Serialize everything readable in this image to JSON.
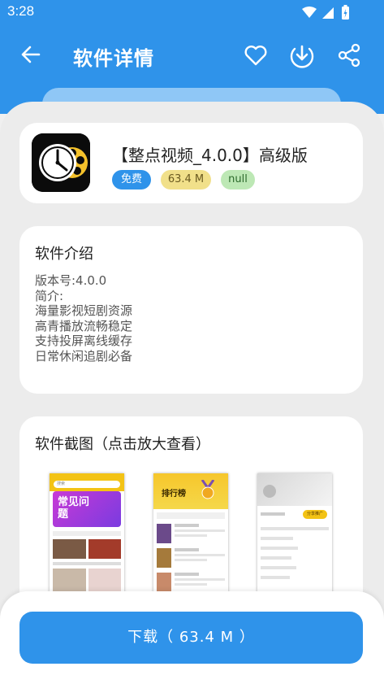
{
  "status_bar": {
    "time": "3:28"
  },
  "header": {
    "title": "软件详情"
  },
  "app": {
    "name": "【整点视频_4.0.0】高级版",
    "tags": {
      "price": "免费",
      "size": "63.4 M",
      "extra": "null"
    }
  },
  "intro": {
    "title": "软件介绍",
    "lines": [
      "版本号:4.0.0",
      "简介:",
      "海量影视短剧资源",
      "高青播放流畅稳定",
      "支持投屏离线缓存",
      "日常休闲追剧必备"
    ]
  },
  "screenshots": {
    "title": "软件截图（点击放大查看）",
    "shot1": {
      "banner": "常见问题",
      "search": "搜索"
    },
    "shot2": {
      "title": "排行榜"
    },
    "shot3": {
      "button": "分享推广"
    }
  },
  "download": {
    "label": "下载（ 63.4 M ）"
  },
  "colors": {
    "primary": "#2f93ea",
    "tag_price": "#2f93ea",
    "tag_size": "#f1e08a",
    "tag_extra": "#bde8b5"
  }
}
